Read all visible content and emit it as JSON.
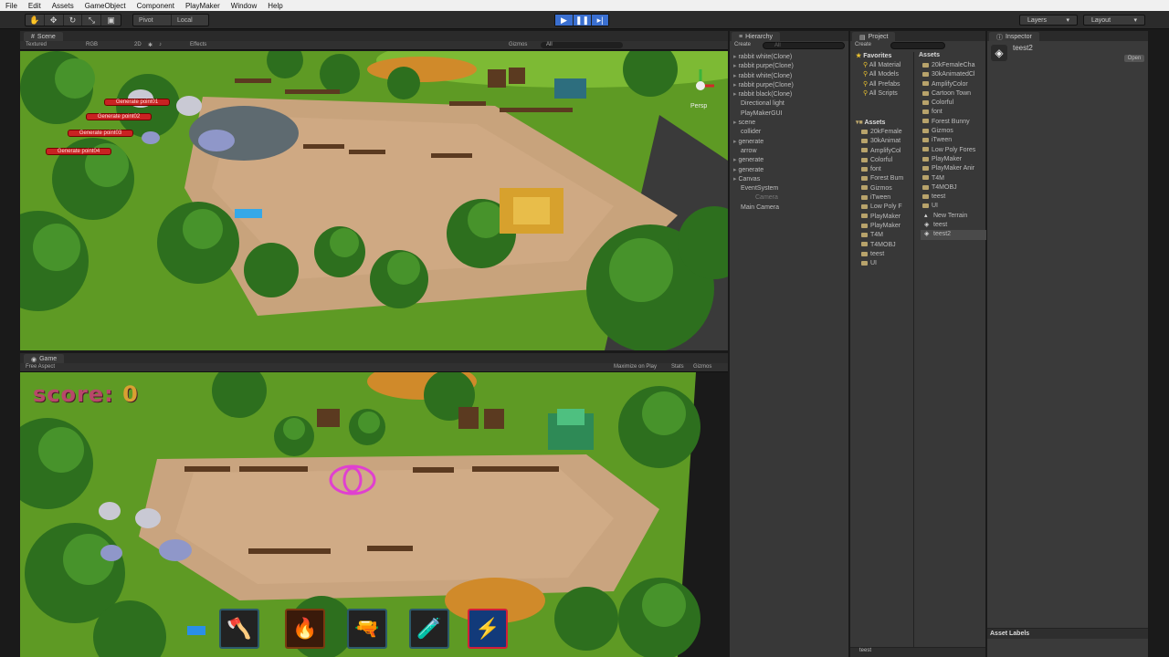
{
  "menu": [
    "File",
    "Edit",
    "Assets",
    "GameObject",
    "Component",
    "PlayMaker",
    "Window",
    "Help"
  ],
  "toolbar": {
    "pivot": "Pivot",
    "local": "Local",
    "layers": "Layers",
    "layout": "Layout"
  },
  "scene": {
    "tab": "Scene",
    "shading": "Textured",
    "render_mode": "RGB",
    "mode_2d": "2D",
    "effects": "Effects",
    "gizmos": "Gizmos",
    "search": "All",
    "persp": "Persp",
    "generate_buttons": [
      "Generate point01",
      "Generate point02",
      "Generate point03",
      "Generate point04"
    ]
  },
  "game": {
    "tab": "Game",
    "aspect": "Free Aspect",
    "maximize": "Maximize on Play",
    "stats": "Stats",
    "gizmos": "Gizmos",
    "score_label": "score:",
    "score_value": "0",
    "skills": [
      "axe-icon",
      "fire-icon",
      "rifle-icon",
      "potion-icon",
      "lightning-icon"
    ]
  },
  "hierarchy": {
    "tab": "Hierarchy",
    "create": "Create",
    "search": "All",
    "items": [
      {
        "label": "rabbit white(Clone)",
        "arrow": true,
        "dim": false
      },
      {
        "label": "rabbit purpe(Clone)",
        "arrow": true,
        "dim": false
      },
      {
        "label": "rabbit white(Clone)",
        "arrow": true,
        "dim": false
      },
      {
        "label": "rabbit purpe(Clone)",
        "arrow": true,
        "dim": false
      },
      {
        "label": "rabbit black(Clone)",
        "arrow": true,
        "dim": false
      },
      {
        "label": "Directional light",
        "arrow": false,
        "dim": false
      },
      {
        "label": "PlayMakerGUI",
        "arrow": false,
        "dim": false
      },
      {
        "label": "scene",
        "arrow": true,
        "dim": false
      },
      {
        "label": "collider",
        "arrow": false,
        "dim": false
      },
      {
        "label": "generate",
        "arrow": true,
        "dim": false
      },
      {
        "label": "arrow",
        "arrow": false,
        "dim": false
      },
      {
        "label": "generate",
        "arrow": true,
        "dim": false
      },
      {
        "label": "generate",
        "arrow": true,
        "dim": false
      },
      {
        "label": "Canvas",
        "arrow": true,
        "dim": false
      },
      {
        "label": "EventSystem",
        "arrow": false,
        "dim": false
      },
      {
        "label": "Camera",
        "arrow": false,
        "dim": true
      },
      {
        "label": "Main Camera",
        "arrow": false,
        "dim": false
      }
    ]
  },
  "project": {
    "tab": "Project",
    "create": "Create",
    "favorites_label": "Favorites",
    "favorites": [
      "All Material",
      "All Models",
      "All Prefabs",
      "All Scripts"
    ],
    "assets_label": "Assets",
    "tree": [
      "20kFemale",
      "30kAnimat",
      "AmplifyCol",
      "Colorful",
      "font",
      "Forest Bum",
      "Gizmos",
      "iTween",
      "Low Poly F",
      "PlayMaker",
      "PlayMaker",
      "T4M",
      "T4MOBJ",
      "teest",
      "UI"
    ],
    "assets_header": "Assets",
    "assets": [
      {
        "label": "20kFemaleCha",
        "kind": "folder"
      },
      {
        "label": "30kAnimatedCl",
        "kind": "folder"
      },
      {
        "label": "AmplifyColor",
        "kind": "folder"
      },
      {
        "label": "Cartoon Town",
        "kind": "folder"
      },
      {
        "label": "Colorful",
        "kind": "folder"
      },
      {
        "label": "font",
        "kind": "folder"
      },
      {
        "label": "Forest Bunny",
        "kind": "folder"
      },
      {
        "label": "Gizmos",
        "kind": "folder"
      },
      {
        "label": "iTween",
        "kind": "folder"
      },
      {
        "label": "Low Poly Fores",
        "kind": "folder"
      },
      {
        "label": "PlayMaker",
        "kind": "folder"
      },
      {
        "label": "PlayMaker Anir",
        "kind": "folder"
      },
      {
        "label": "T4M",
        "kind": "folder"
      },
      {
        "label": "T4MOBJ",
        "kind": "folder"
      },
      {
        "label": "teest",
        "kind": "folder"
      },
      {
        "label": "UI",
        "kind": "folder"
      },
      {
        "label": "New Terrain",
        "kind": "terrain"
      },
      {
        "label": "teest",
        "kind": "scene"
      },
      {
        "label": "teest2",
        "kind": "scene"
      }
    ],
    "footer": "teest"
  },
  "inspector": {
    "tab": "Inspector",
    "object_name": "teest2",
    "open": "Open",
    "asset_labels": "Asset Labels"
  }
}
